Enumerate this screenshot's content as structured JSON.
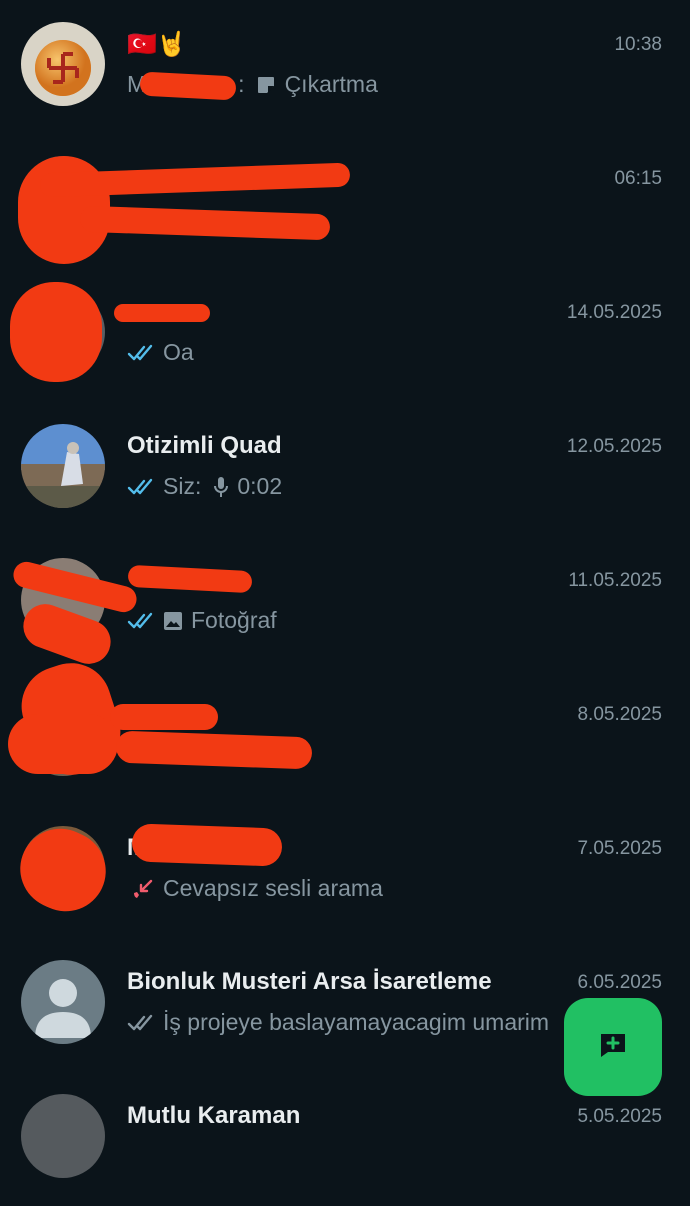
{
  "chats": [
    {
      "name": "🇹🇷🤘",
      "time": "10:38",
      "preview_prefix": "M",
      "preview_sender": ":",
      "preview_text": "Çıkartma",
      "preview_icon": "sticker-icon"
    },
    {
      "name": "",
      "time": "06:15",
      "preview_text": ""
    },
    {
      "name": "",
      "time": "14.05.2025",
      "preview_text": "Oa",
      "preview_icon": "double-check-read-icon"
    },
    {
      "name": "Otizimli Quad",
      "time": "12.05.2025",
      "preview_sender": "Siz:",
      "preview_text": "0:02",
      "preview_icon": "microphone-icon"
    },
    {
      "name": "",
      "time": "11.05.2025",
      "preview_text": "Fotoğraf",
      "preview_icon": "photo-icon"
    },
    {
      "name": "",
      "time": "8.05.2025",
      "preview_text": ""
    },
    {
      "name": "M",
      "time": "7.05.2025",
      "preview_text": "Cevapsız sesli arama",
      "preview_icon": "missed-call-icon"
    },
    {
      "name": "Bionluk Musteri Arsa İsaretleme",
      "time": "6.05.2025",
      "preview_text": "İş projeye baslayamayacagim umarim",
      "preview_icon": "double-check-icon"
    },
    {
      "name": "Mutlu Karaman",
      "time": "5.05.2025",
      "preview_text": ""
    }
  ],
  "colors": {
    "background": "#0b141a",
    "name": "#e9edef",
    "secondary": "#8696a0",
    "read_tick": "#53bdeb",
    "missed_call": "#f15c6d",
    "fab": "#21c063",
    "redaction": "#f23a13"
  },
  "fab": {
    "icon": "new-chat-icon"
  }
}
